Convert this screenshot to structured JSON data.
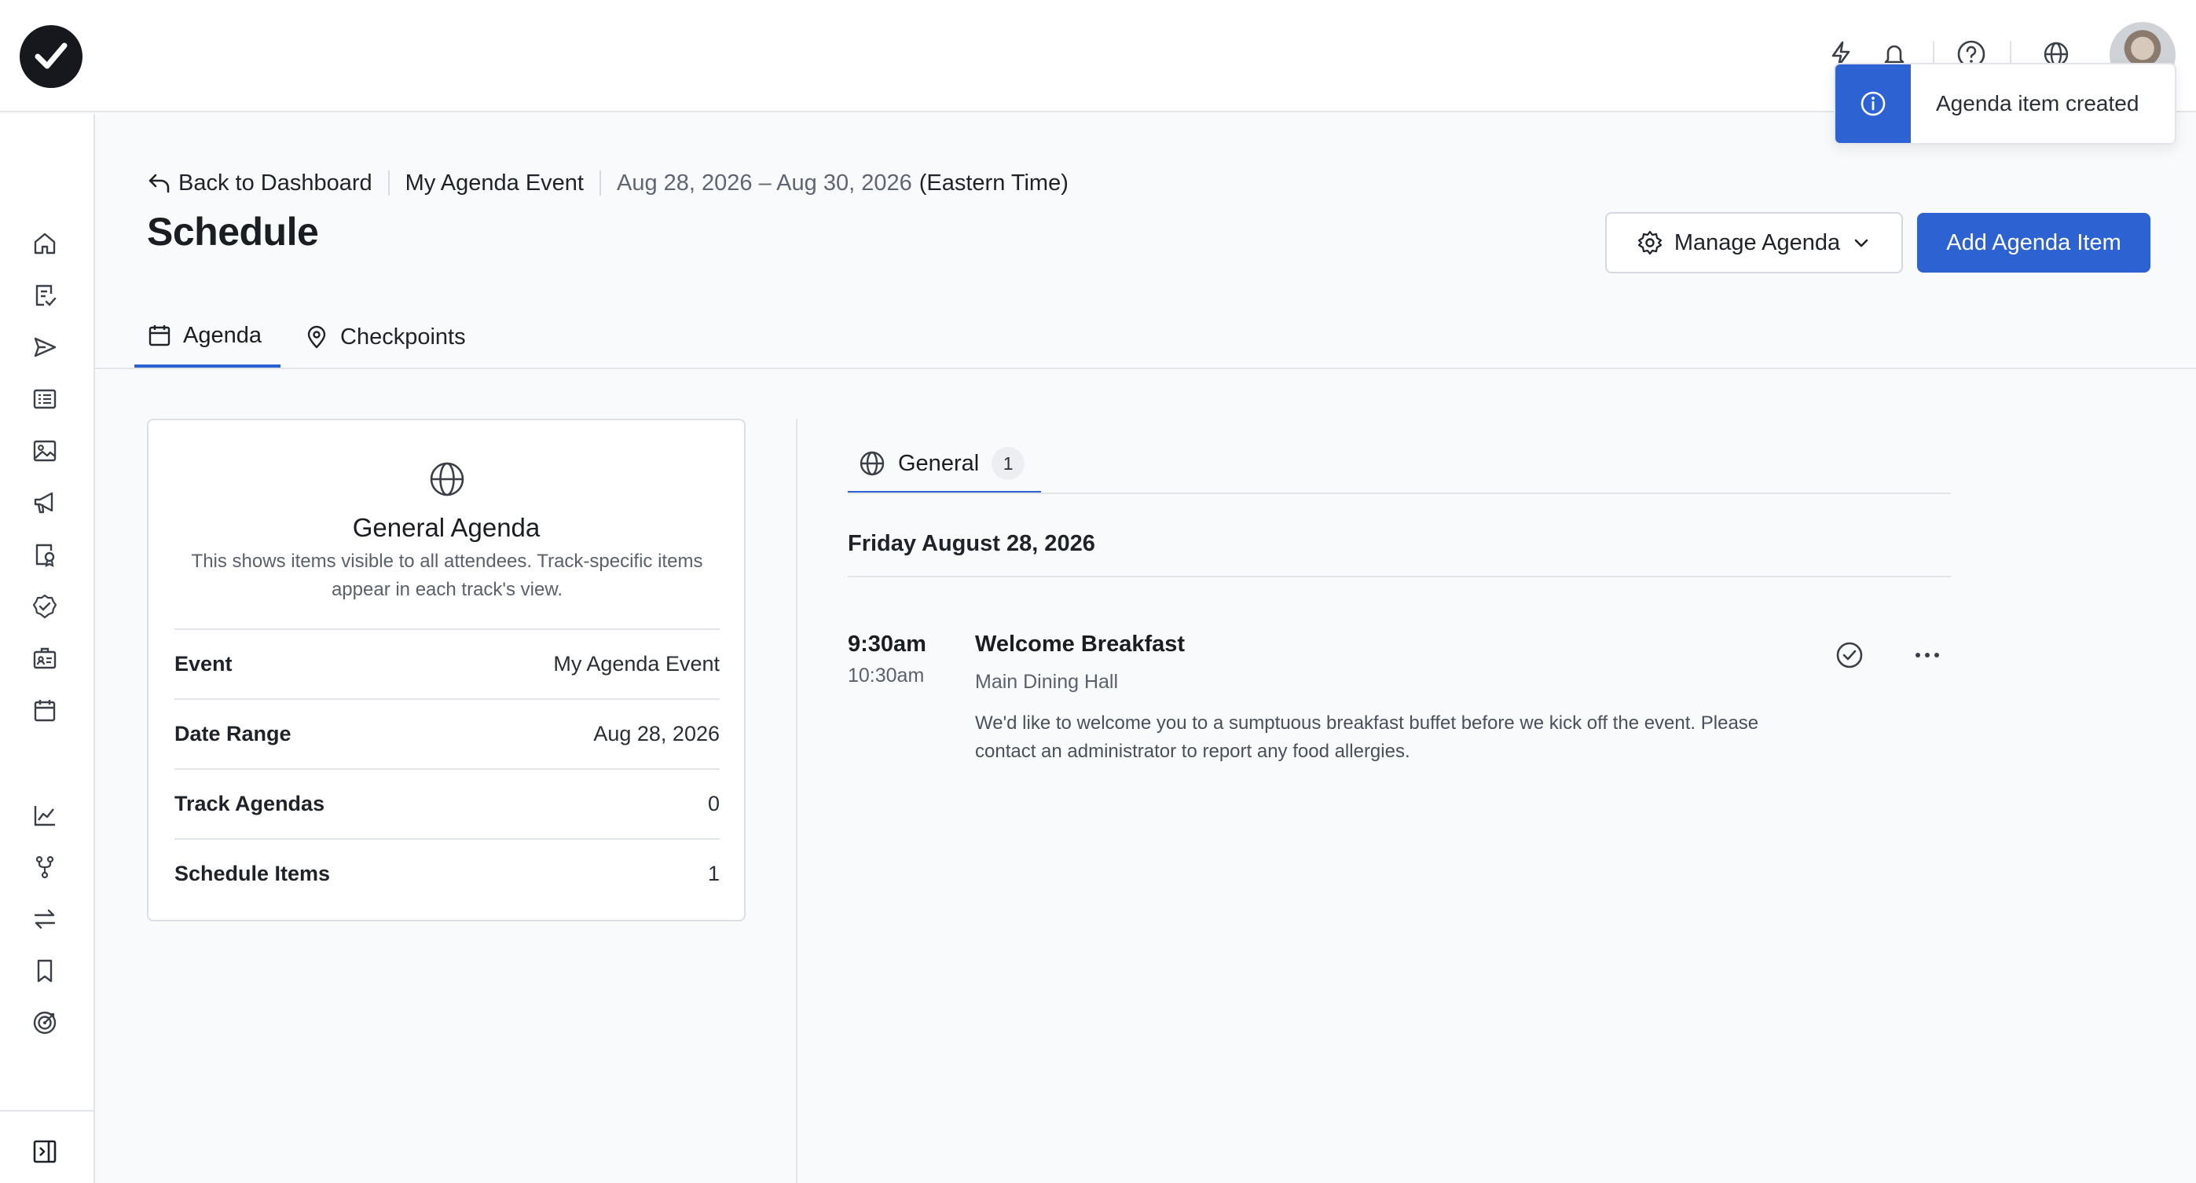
{
  "toast": {
    "message": "Agenda item created"
  },
  "breadcrumb": {
    "back_label": "Back to Dashboard",
    "event_name": "My Agenda Event",
    "dates": "Aug 28, 2026 – Aug 30, 2026",
    "timezone": "(Eastern Time)"
  },
  "page": {
    "title": "Schedule"
  },
  "actions": {
    "manage_label": "Manage Agenda",
    "add_label": "Add Agenda Item"
  },
  "tabs": [
    {
      "label": "Agenda",
      "icon": "calendar-icon",
      "active": true
    },
    {
      "label": "Checkpoints",
      "icon": "map-pin-icon",
      "active": false
    }
  ],
  "summary_card": {
    "icon": "globe-icon",
    "title": "General Agenda",
    "description": "This shows items visible to all attendees. Track-specific items appear in each track's view.",
    "rows": [
      {
        "key": "Event",
        "value": "My Agenda Event"
      },
      {
        "key": "Date Range",
        "value": "Aug 28, 2026"
      },
      {
        "key": "Track Agendas",
        "value": "0"
      },
      {
        "key": "Schedule Items",
        "value": "1"
      }
    ]
  },
  "agenda_tab": {
    "label": "General",
    "count": "1"
  },
  "day": {
    "heading": "Friday August 28, 2026"
  },
  "items": [
    {
      "start": "9:30am",
      "end": "10:30am",
      "title": "Welcome Breakfast",
      "location": "Main Dining Hall",
      "description": "We'd like to welcome you to a sumptuous breakfast buffet before we kick off the event. Please contact an administrator to report any food allergies."
    }
  ],
  "colors": {
    "accent": "#2d62d2",
    "text": "#1f2329",
    "muted": "#5a616c",
    "border": "#e3e5ea"
  }
}
